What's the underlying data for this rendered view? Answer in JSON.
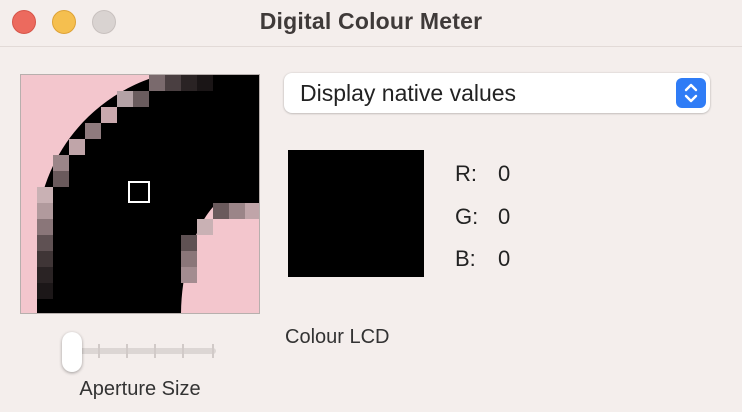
{
  "window": {
    "title": "Digital Colour Meter"
  },
  "traffic_lights": {
    "close": "#ec6a5e",
    "minimize": "#f5bf4f",
    "zoom": "#d9d3d1"
  },
  "magnifier": {
    "colors": {
      "pink": "#f3c6cd",
      "black": "#000000"
    },
    "aperture_icon": "square-outline"
  },
  "aperture": {
    "label": "Aperture Size",
    "level": 0
  },
  "mode_select": {
    "value": "Display native values",
    "stepper_icon": "up-down-chevron-icon",
    "accent": "#2f7cf6"
  },
  "readout": {
    "swatch_color": "#000000",
    "channels": [
      {
        "label": "R:",
        "value": "0"
      },
      {
        "label": "G:",
        "value": "0"
      },
      {
        "label": "B:",
        "value": "0"
      }
    ]
  },
  "display": {
    "name": "Colour LCD"
  }
}
